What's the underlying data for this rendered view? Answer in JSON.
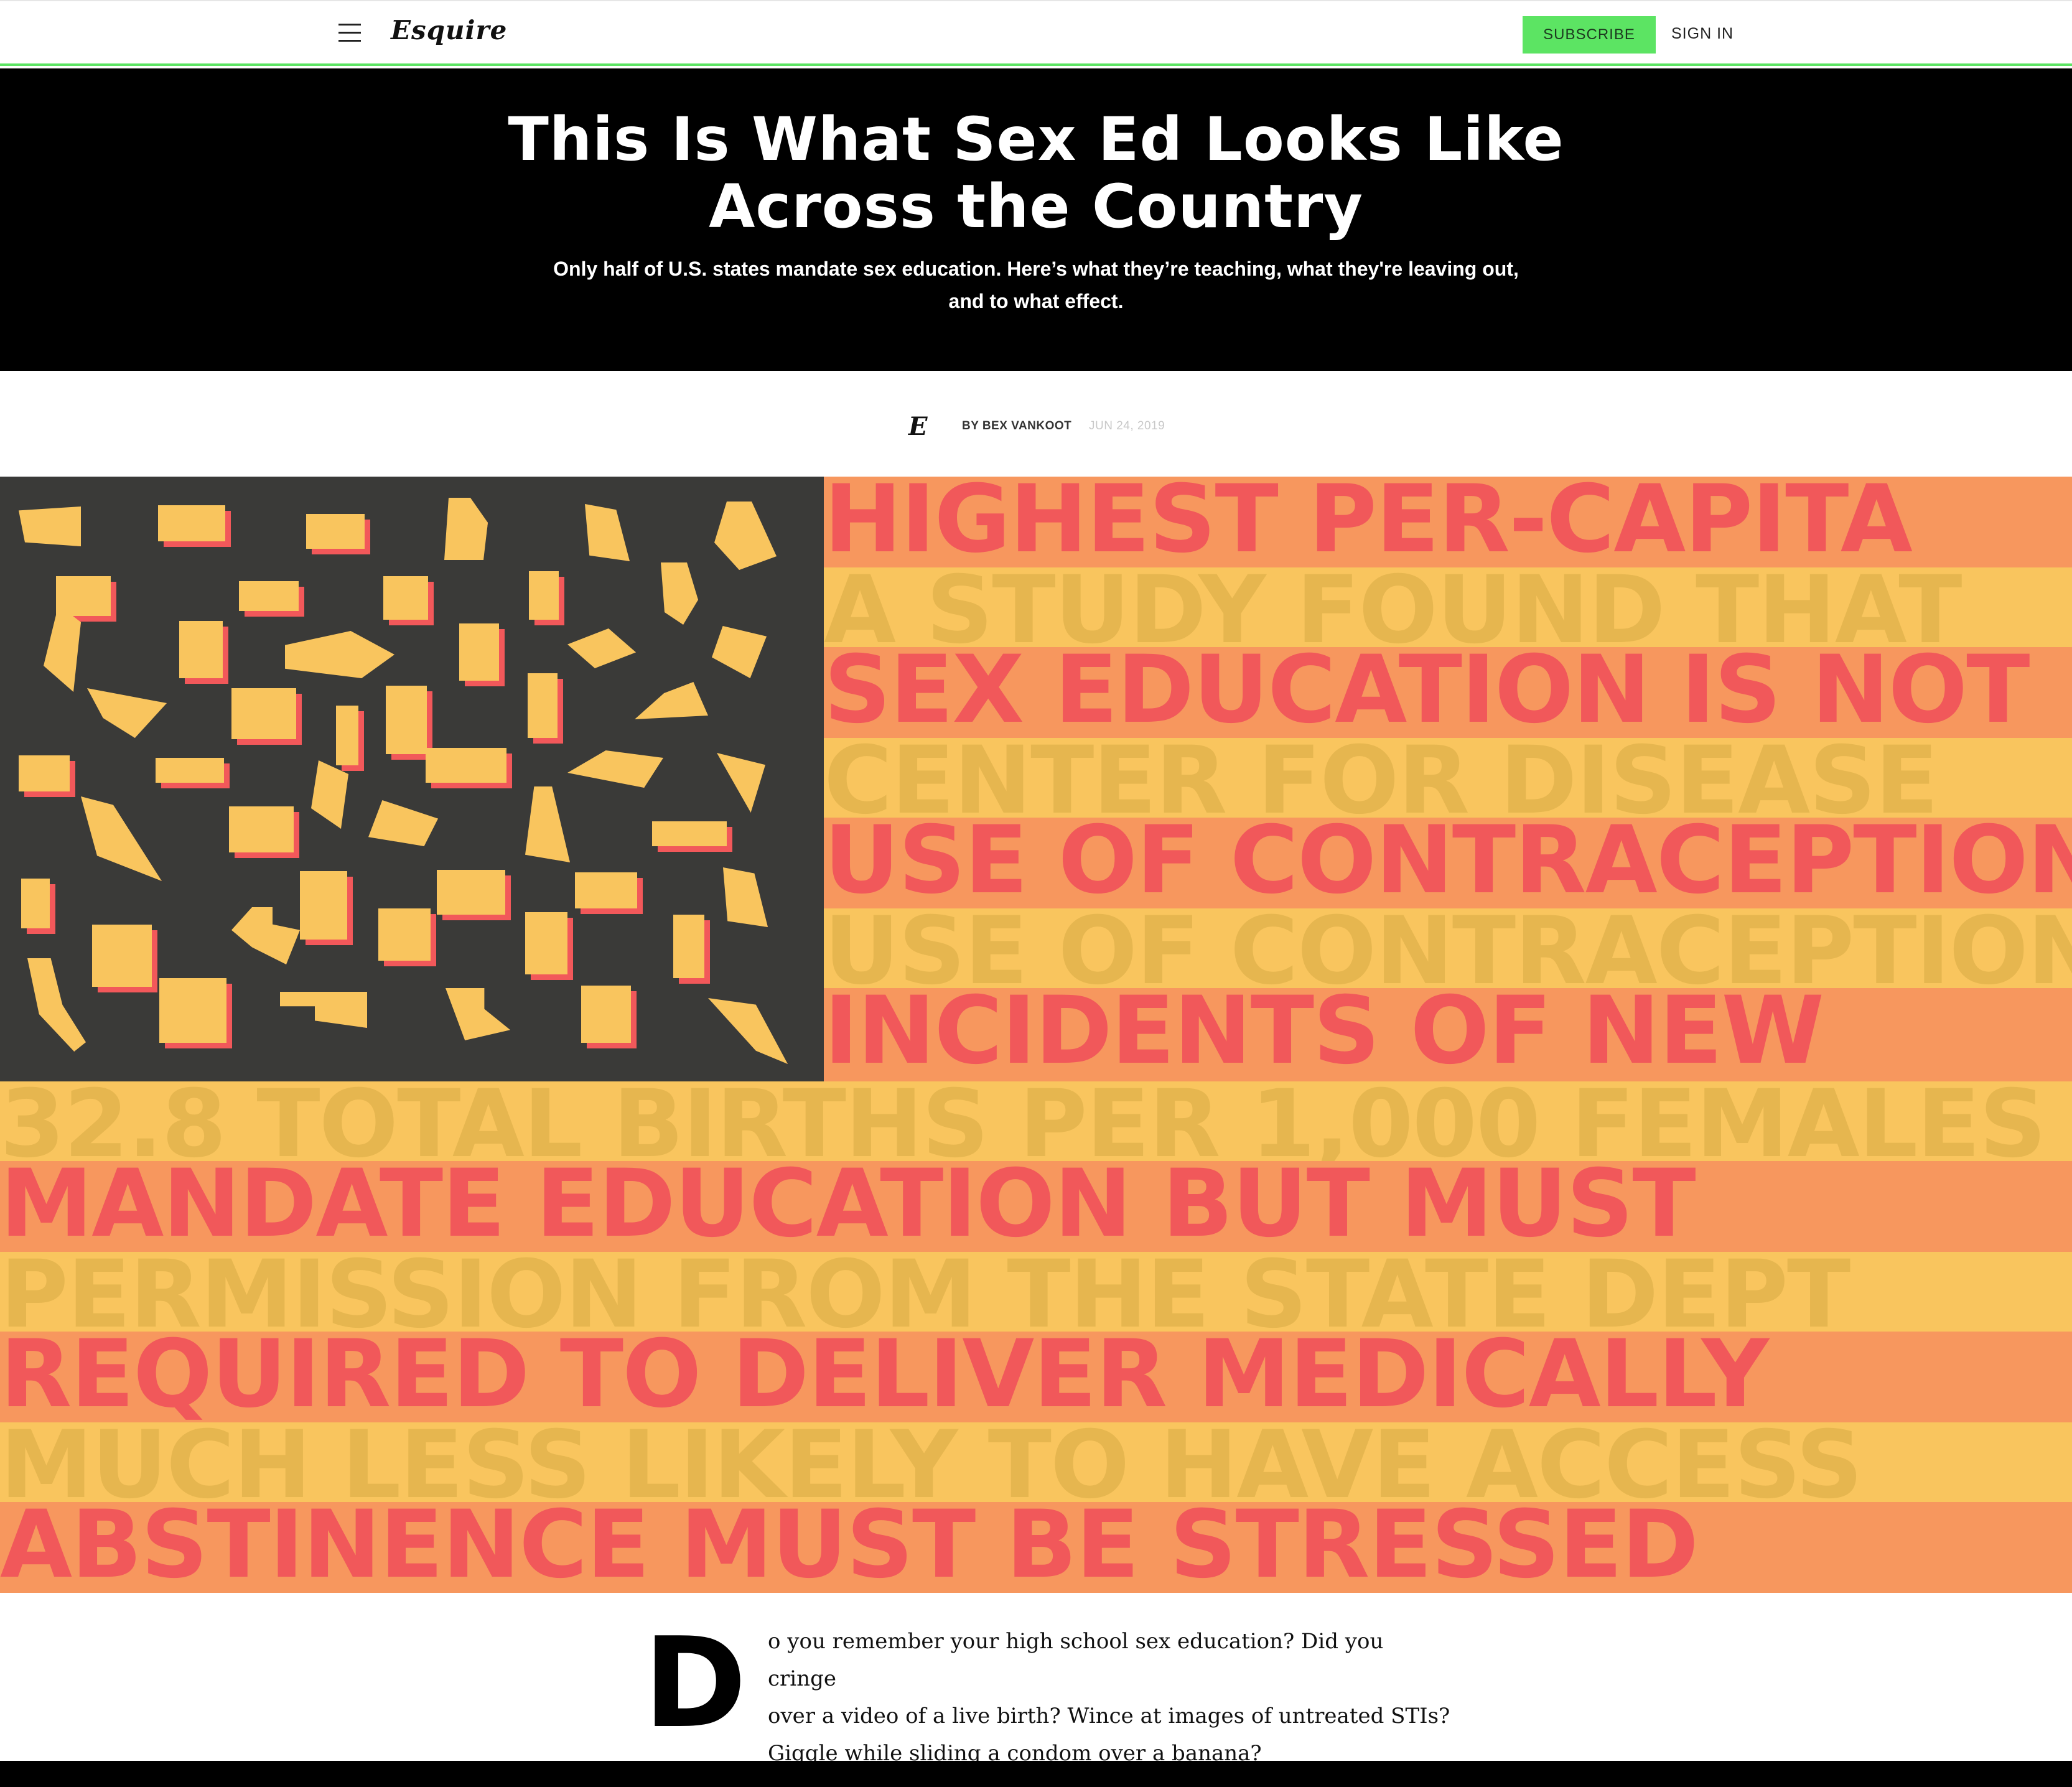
{
  "header": {
    "logo": "Esquire",
    "subscribe_label": "SUBSCRIBE",
    "signin_label": "SIGN IN"
  },
  "hero": {
    "title_line1": "This Is What Sex Ed Looks Like",
    "title_line2": "Across the Country",
    "dek_line1": "Only half of U.S. states mandate sex education. Here’s what they’re teaching, what they're leaving out,",
    "dek_line2": "and to what effect."
  },
  "byline": {
    "mark": "E",
    "author": "BY BEX VANKOOT",
    "date": "JUN 24, 2019"
  },
  "flag_stripes": [
    "HIGHEST PER-CAPITA",
    "A STUDY FOUND THAT",
    "SEX EDUCATION IS NOT",
    "CENTER FOR DISEASE",
    "USE OF CONTRACEPTION",
    "USE OF CONTRACEPTION",
    "INCIDENTS OF NEW",
    "32.8 TOTAL BIRTHS PER 1,000 FEMALES",
    "MANDATE EDUCATION BUT MUST",
    "PERMISSION FROM THE STATE DEPT",
    "REQUIRED TO DELIVER MEDICALLY",
    "MUCH LESS LIKELY TO HAVE ACCESS",
    "ABSTINENCE MUST BE STRESSED"
  ],
  "article": {
    "dropcap": "D",
    "lede_line1": "o you remember your high school sex education? Did you cringe",
    "lede_line2": "over a video of a live birth? Wince at images of untreated STIs?",
    "lede_line3": "Giggle while sliding a condom over a banana?"
  },
  "colors": {
    "accent_green": "#5ce463",
    "stripe_red_bg": "#f7975e",
    "stripe_red_text": "#f1585a",
    "stripe_yellow_bg": "#f9c55e",
    "canton": "#3a3a38"
  }
}
